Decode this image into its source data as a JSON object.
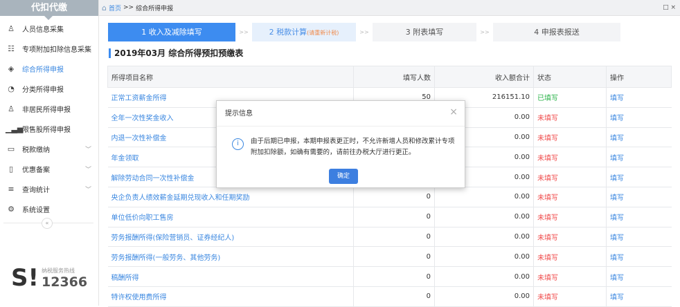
{
  "sidebar": {
    "title": "代扣代缴",
    "items": [
      {
        "label": "人员信息采集",
        "icon": "person-icon",
        "glyph": "♙"
      },
      {
        "label": "专项附加扣除信息采集",
        "icon": "list-icon",
        "glyph": "☷",
        "chevron": true
      },
      {
        "label": "综合所得申报",
        "icon": "layers-icon",
        "glyph": "◈",
        "active": true
      },
      {
        "label": "分类所得申报",
        "icon": "clock-icon",
        "glyph": "◔"
      },
      {
        "label": "非居民所得申报",
        "icon": "user-icon",
        "glyph": "♙"
      },
      {
        "label": "限售股所得申报",
        "icon": "bar-chart-icon",
        "glyph": "▁▃▅"
      },
      {
        "label": "税款缴纳",
        "icon": "folder-icon",
        "glyph": "▭",
        "chevron": true
      },
      {
        "label": "优惠备案",
        "icon": "document-icon",
        "glyph": "▯",
        "chevron": true
      },
      {
        "label": "查询统计",
        "icon": "search-list-icon",
        "glyph": "≡",
        "chevron": true
      },
      {
        "label": "系统设置",
        "icon": "gear-icon",
        "glyph": "⚙"
      }
    ],
    "collapse": "«",
    "hotline_label": "纳税服务热线",
    "hotline_number": "12366"
  },
  "topbar": {
    "home": "首页",
    "sep": ">>",
    "current": "综合所得申报",
    "window_controls": "□ ×"
  },
  "steps": [
    {
      "label": "1 收入及减除填写"
    },
    {
      "label": "2 税款计算",
      "note": "(请重新计税)"
    },
    {
      "label": "3 附表填写"
    },
    {
      "label": "4 申报表报送"
    }
  ],
  "step_sep": ">>",
  "title": "2019年03月  综合所得预扣预缴表",
  "table": {
    "headers": [
      "所得项目名称",
      "填写人数",
      "收入额合计",
      "状态",
      "操作"
    ],
    "rows": [
      {
        "name": "正常工资薪金所得",
        "count": "50",
        "income": "216151.10",
        "status": "已填写",
        "op": "填写",
        "ok": true
      },
      {
        "name": "全年一次性奖金收入",
        "count": "",
        "income": "0.00",
        "status": "未填写",
        "op": "填写"
      },
      {
        "name": "内退一次性补偿金",
        "count": "",
        "income": "0.00",
        "status": "未填写",
        "op": "填写"
      },
      {
        "name": "年金领取",
        "count": "",
        "income": "0.00",
        "status": "未填写",
        "op": "填写"
      },
      {
        "name": "解除劳动合同一次性补偿金",
        "count": "",
        "income": "0.00",
        "status": "未填写",
        "op": "填写"
      },
      {
        "name": "央企负责人绩效薪金延期兑现收入和任期奖励",
        "count": "0",
        "income": "0.00",
        "status": "未填写",
        "op": "填写"
      },
      {
        "name": "单位低价向职工售房",
        "count": "0",
        "income": "0.00",
        "status": "未填写",
        "op": "填写"
      },
      {
        "name": "劳务报酬所得(保险营销员、证券经纪人)",
        "count": "0",
        "income": "0.00",
        "status": "未填写",
        "op": "填写"
      },
      {
        "name": "劳务报酬所得(一般劳务、其他劳务)",
        "count": "0",
        "income": "0.00",
        "status": "未填写",
        "op": "填写"
      },
      {
        "name": "稿酬所得",
        "count": "0",
        "income": "0.00",
        "status": "未填写",
        "op": "填写"
      },
      {
        "name": "特许权使用费所得",
        "count": "0",
        "income": "0.00",
        "status": "未填写",
        "op": "填写"
      }
    ]
  },
  "dialog": {
    "title": "提示信息",
    "close": "×",
    "icon": "info-icon",
    "message": "由于后期已申报，本期申报表更正时，不允许新增人员和修改累计专项附加扣除额，如确有需要的，请前往办税大厅进行更正。",
    "confirm": "确定"
  },
  "colors": {
    "accent": "#3d8cf0",
    "status_done": "#2bb34a",
    "status_todo": "#f04a4a"
  }
}
